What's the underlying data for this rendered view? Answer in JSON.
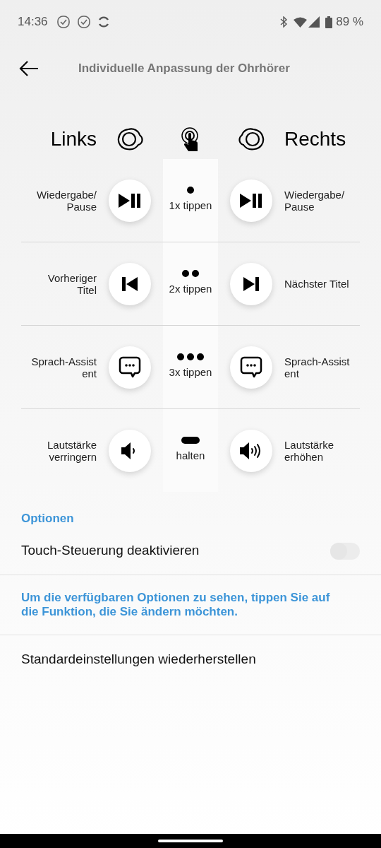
{
  "status_bar": {
    "time": "14:36",
    "battery": "89 %"
  },
  "header": {
    "title": "Individuelle Anpassung der Ohrhörer"
  },
  "sides": {
    "left": "Links",
    "right": "Rechts"
  },
  "gestures": [
    {
      "gesture": {
        "kind": "single",
        "label": "1x tippen"
      },
      "left": {
        "kind": "play_pause",
        "label": "Wiedergabe/\nPause"
      },
      "right": {
        "kind": "play_pause",
        "label": "Wiedergabe/\nPause"
      }
    },
    {
      "gesture": {
        "kind": "double",
        "label": "2x tippen"
      },
      "left": {
        "kind": "previous",
        "label": "Vorheriger\nTitel"
      },
      "right": {
        "kind": "next",
        "label": "Nächster Titel"
      }
    },
    {
      "gesture": {
        "kind": "triple",
        "label": "3x tippen"
      },
      "left": {
        "kind": "assistant",
        "label": "Sprach-Assist\nent"
      },
      "right": {
        "kind": "assistant",
        "label": "Sprach-Assist\nent"
      }
    },
    {
      "gesture": {
        "kind": "hold",
        "label": "halten"
      },
      "left": {
        "kind": "volume_down",
        "label": "Lautstärke\nverringern"
      },
      "right": {
        "kind": "volume_up",
        "label": "Lautstärke\nerhöhen"
      }
    }
  ],
  "options": {
    "heading": "Optionen",
    "toggle": {
      "label": "Touch-Steuerung deaktivieren",
      "on": false
    },
    "hint": "Um die verfügbaren Optionen zu sehen, tippen Sie auf die Funktion, die Sie ändern möchten.",
    "reset": "Standardeinstellungen wiederherstellen"
  }
}
